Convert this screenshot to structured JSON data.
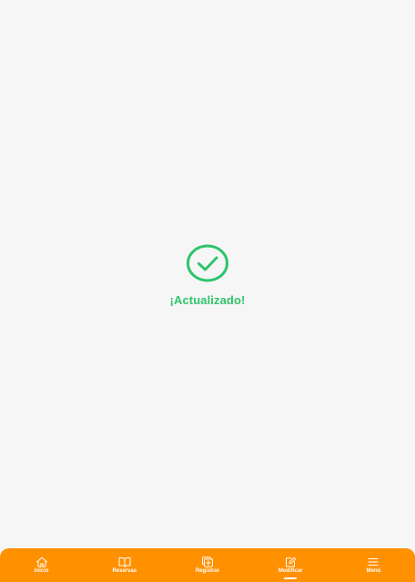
{
  "status": {
    "message": "¡Actualizado!",
    "icon": "check-circle-icon",
    "color": "#2fc46a"
  },
  "bottom_nav": {
    "background": "#ff9000",
    "active_index": 3,
    "items": [
      {
        "label": "Inicio",
        "icon": "home-icon"
      },
      {
        "label": "Reservas",
        "icon": "book-icon"
      },
      {
        "label": "Registrar",
        "icon": "add-square-icon"
      },
      {
        "label": "Modificar",
        "icon": "edit-icon"
      },
      {
        "label": "Menú",
        "icon": "menu-icon"
      }
    ]
  }
}
